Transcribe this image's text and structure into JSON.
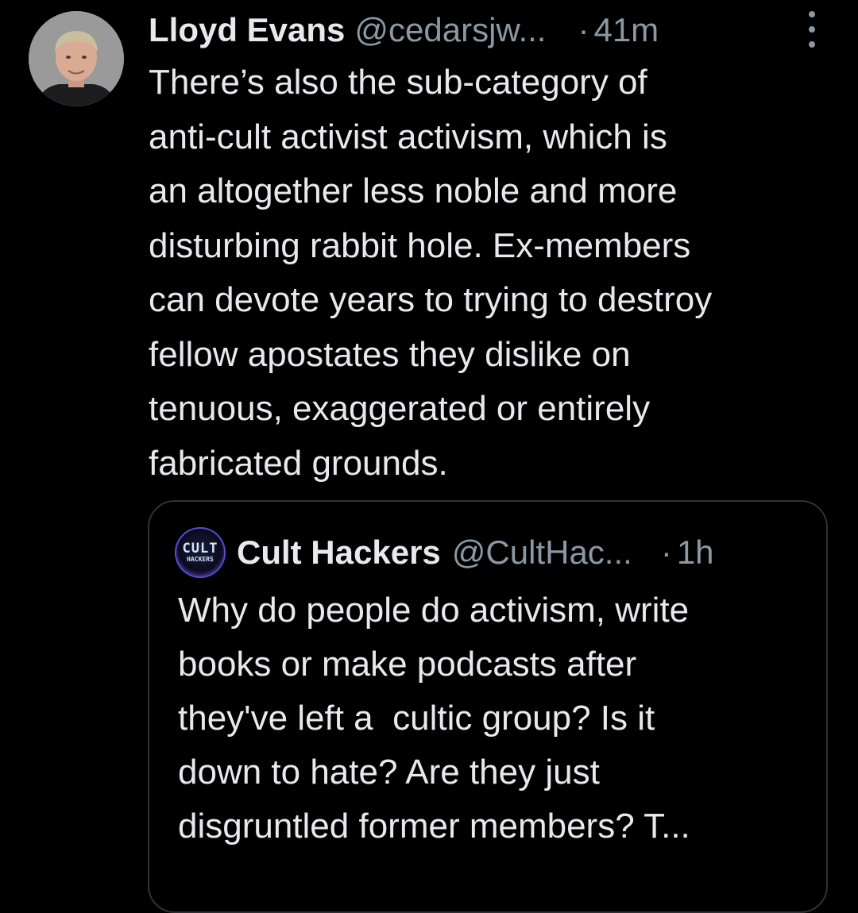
{
  "tweet": {
    "author_name": "Lloyd Evans",
    "author_handle": "@cedarsjw...",
    "separator": "·",
    "time": "41m",
    "more_icon": "more-vertical-icon",
    "body_lines": [
      "There’s also the sub-category of",
      "anti-cult activist activism, which is",
      "an altogether less noble and more",
      "disturbing rabbit hole. Ex-members",
      "can devote years to trying to destroy",
      "fellow apostates they dislike on",
      "tenuous, exaggerated or entirely",
      "fabricated grounds."
    ]
  },
  "quote": {
    "avatar_logo_top": "CULT",
    "avatar_logo_bottom": "HACKERS",
    "author_name": "Cult Hackers",
    "author_handle": "@CultHac...",
    "separator": "·",
    "time": "1h",
    "body_lines": [
      "Why do people do activism, write",
      "books or make podcasts after",
      "they've left a  cultic group? Is it",
      "down to hate? Are they just",
      "disgruntled former members? T..."
    ]
  },
  "colors": {
    "background": "#000000",
    "text_primary": "#e7e9ea",
    "text_secondary": "#8b98a5",
    "card_border": "#2f3336"
  }
}
